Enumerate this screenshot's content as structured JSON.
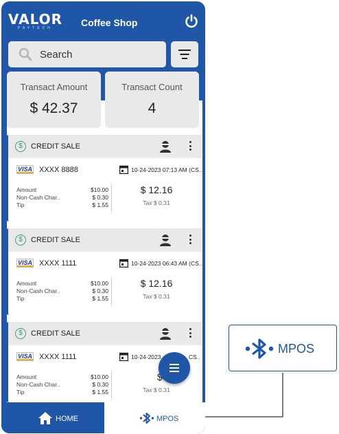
{
  "header": {
    "logo_text": "VALOR",
    "logo_sub": "PAYTECH",
    "title": "Coffee Shop",
    "power_icon": "power-icon"
  },
  "search": {
    "placeholder": "Search",
    "filter_icon": "filter-icon"
  },
  "stats": {
    "amount_label": "Transact Amount",
    "amount_value": "$ 42.37",
    "count_label": "Transact Count",
    "count_value": "4"
  },
  "transactions": [
    {
      "type": "CREDIT SALE",
      "card_brand": "VISA",
      "card_number": "XXXX 8888",
      "date": "10-24-2023 07:13 AM (CS..",
      "amount_label": "Amount",
      "amount": "$10.00",
      "noncash_label": "Non-Cash Char..",
      "noncash": "$ 0.30",
      "tip_label": "Tip",
      "tip": "$ 1.55",
      "total": "$ 12.16",
      "tax": "Tax $ 0.31"
    },
    {
      "type": "CREDIT SALE",
      "card_brand": "VISA",
      "card_number": "XXXX 1111",
      "date": "10-24-2023 06:43 AM (CS..",
      "amount_label": "Amount",
      "amount": "$10.00",
      "noncash_label": "Non-Cash Char..",
      "noncash": "$ 0.30",
      "tip_label": "Tip",
      "tip": "$ 1.55",
      "total": "$ 12.16",
      "tax": "Tax $ 0.31"
    },
    {
      "type": "CREDIT SALE",
      "card_brand": "VISA",
      "card_number": "XXXX 1111",
      "date": "10-24-2023",
      "date_tail": "CS..",
      "amount_label": "Amount",
      "amount": "$10.00",
      "noncash_label": "Non-Cash Char..",
      "noncash": "$ 0.30",
      "tip_label": "Tip",
      "tip": "$ 1.55",
      "total": "$ 12.",
      "tax": "Tax $ 0.31"
    }
  ],
  "bottom_nav": {
    "home_label": "HOME",
    "mpos_label": "MPOS"
  },
  "callout": {
    "label": "MPOS"
  },
  "colors": {
    "brand_blue": "#1f56a8",
    "card_gray": "#e9e9e9",
    "success_green": "#38a06a"
  }
}
